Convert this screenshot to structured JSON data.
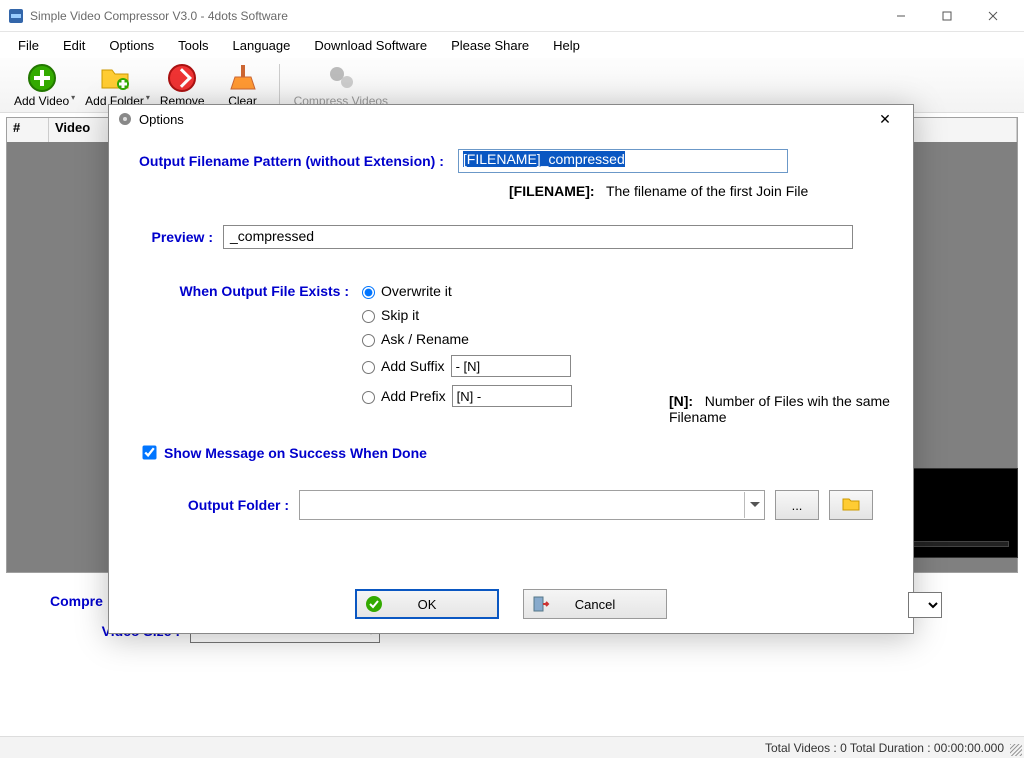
{
  "window": {
    "title": "Simple Video Compressor V3.0 - 4dots Software"
  },
  "menu": [
    "File",
    "Edit",
    "Options",
    "Tools",
    "Language",
    "Download Software",
    "Please Share",
    "Help"
  ],
  "toolbar": {
    "add_video": "Add Video",
    "add_folder": "Add Folder",
    "remove": "Remove",
    "clear": "Clear",
    "compress": "Compress Videos"
  },
  "grid": {
    "col_num": "#",
    "col_video": "Video"
  },
  "lower": {
    "compress_label": "Compre",
    "size_label": "Video Size :"
  },
  "status": {
    "text": "Total Videos : 0  Total Duration : 00:00:00.000"
  },
  "dialog": {
    "title": "Options",
    "pattern_label": "Output Filename Pattern (without Extension)  :",
    "pattern_value": "[FILENAME]_compressed",
    "pattern_sel": "[FILENAME]_compressed",
    "filename_help_key": "[FILENAME]:",
    "filename_help_text": "The filename of the first Join File",
    "preview_label": "Preview :",
    "preview_value": "_compressed",
    "exists_label": "When Output File Exists  :",
    "radios": {
      "overwrite": "Overwrite it",
      "skip": "Skip it",
      "ask": "Ask / Rename",
      "suffix": "Add Suffix",
      "prefix": "Add Prefix"
    },
    "suffix_value": "- [N]",
    "prefix_value": "[N] -",
    "n_help_key": "[N]:",
    "n_help_text": "Number of Files wih the same Filename",
    "show_msg": "Show Message on Success When Done",
    "output_folder_label": "Output Folder :",
    "browse_dots": "...",
    "ok": "OK",
    "cancel": "Cancel"
  }
}
